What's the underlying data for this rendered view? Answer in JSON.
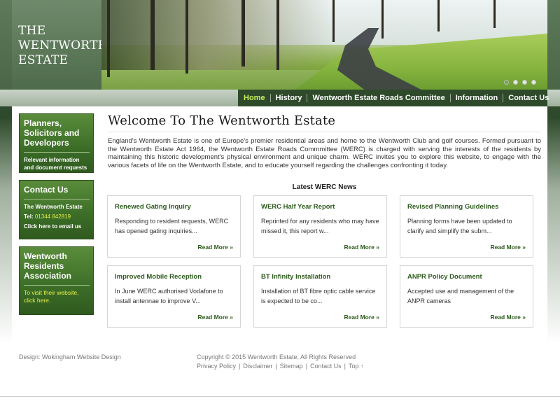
{
  "logo": {
    "line1": "THE",
    "line2": "WENTWORTH",
    "line3": "ESTATE"
  },
  "nav": {
    "home": "Home",
    "history": "History",
    "roads_committee": "Wentworth Estate Roads Committee",
    "information": "Information",
    "contact": "Contact Us"
  },
  "sidebar": {
    "planners": {
      "title": "Planners, Solicitors and Developers",
      "text": "Relevant information and document requests"
    },
    "contact": {
      "title": "Contact Us",
      "name": "The Wentworth Estate",
      "tel_label": "Tel: ",
      "tel": "01344 842819",
      "email": "Click here to email us"
    },
    "residents": {
      "title": "Wentworth Residents Association",
      "text": "To visit  their website, click here."
    }
  },
  "main": {
    "heading": "Welcome To The Wentworth Estate",
    "intro": "England's Wentworth Estate is one of Europe's premier residential areas and home to the Wentworth Club and golf courses.  Formed pursuant to the Wentworth Estate Act 1964, the Wentworth Estate Roads Commmittee (WERC) is charged with serving the interests of the residents by maintaining this historic development's physical environment and unique charm.  WERC invites you to explore this website, to engage with the various facets of life on the Wentworth Estate, and to educate yourself regarding the challenges confronting it today.",
    "news_heading": "Latest WERC News",
    "read_more": "Read More »",
    "news": [
      {
        "title": "Renewed Gating Inquiry",
        "body": "Responding to resident requests, WERC has opened gating inquiries..."
      },
      {
        "title": "WERC Half Year Report",
        "body": "Reprinted for any residents who may have missed it, this report w..."
      },
      {
        "title": "Revised Planning Guidelines",
        "body": "Planning forms have been updated to clarify and simplify the subm..."
      },
      {
        "title": "Improved Mobile Reception",
        "body": "In June WERC authorised Vodafone to install antennae to improve V..."
      },
      {
        "title": "BT Infinity Installation",
        "body": "Installation of BT fibre optic cable service is expected to be co..."
      },
      {
        "title": "ANPR Policy Document",
        "body": "Accepted use and management of the ANPR cameras"
      }
    ]
  },
  "footer": {
    "design": "Design: Wokingham Website Design",
    "copyright": "Copyright © 2015 Wentworth Estate, All Rights Reserved",
    "privacy": "Privacy Policy",
    "disclaimer": "Disclaimer",
    "sitemap": "Sitemap",
    "contact": "Contact Us",
    "top": "Top ↑",
    "separator": "|"
  },
  "colors": {
    "brand_green": "#2d5a1c",
    "nav_active": "#c8f05a",
    "accent_yellow": "#e8f04a"
  },
  "slider": {
    "dot_count": 4,
    "active_index": 0
  }
}
